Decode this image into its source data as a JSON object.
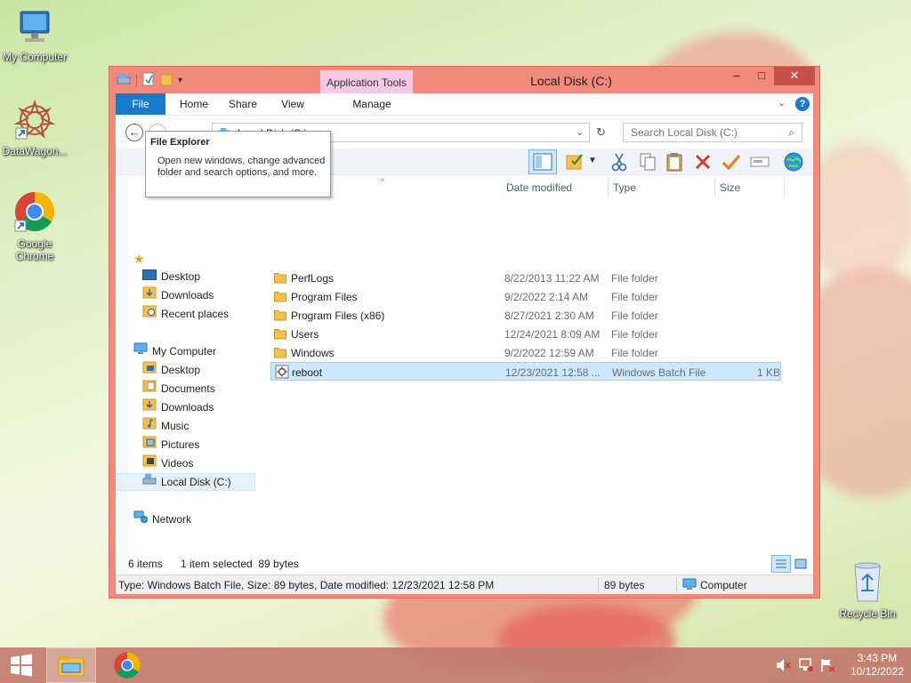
{
  "desktop": {
    "icons": [
      {
        "label": "My Computer"
      },
      {
        "label": "DataWagon..."
      },
      {
        "label": "Google Chrome"
      },
      {
        "label": "Recycle Bin"
      }
    ]
  },
  "window": {
    "title": "Local Disk (C:)",
    "context_tab": "Application Tools",
    "controls": {
      "minimize": "–",
      "maximize": "□",
      "close": "✕"
    }
  },
  "ribbon": {
    "tabs": [
      "File",
      "Home",
      "Share",
      "View",
      "Manage"
    ]
  },
  "address": {
    "path": "Local Disk (C:)",
    "search_placeholder": "Search Local Disk (C:)"
  },
  "tooltip": {
    "title": "File Explorer",
    "body": "Open new windows, change advanced folder and search options, and more."
  },
  "nav": {
    "favorites": [
      "Desktop",
      "Downloads",
      "Recent places"
    ],
    "computer_label": "My Computer",
    "computer_items": [
      "Desktop",
      "Documents",
      "Downloads",
      "Music",
      "Pictures",
      "Videos",
      "Local Disk (C:)"
    ],
    "network_label": "Network"
  },
  "columns": [
    "Date modified",
    "Type",
    "Size"
  ],
  "files": [
    {
      "name": "PerfLogs",
      "date": "8/22/2013 11:22 AM",
      "type": "File folder",
      "size": ""
    },
    {
      "name": "Program Files",
      "date": "9/2/2022 2:14 AM",
      "type": "File folder",
      "size": ""
    },
    {
      "name": "Program Files (x86)",
      "date": "8/27/2021 2:30 AM",
      "type": "File folder",
      "size": ""
    },
    {
      "name": "Users",
      "date": "12/24/2021 8:09 AM",
      "type": "File folder",
      "size": ""
    },
    {
      "name": "Windows",
      "date": "9/2/2022 12:59 AM",
      "type": "File folder",
      "size": ""
    },
    {
      "name": "reboot",
      "date": "12/23/2021 12:58 ...",
      "type": "Windows Batch File",
      "size": "1 KB"
    }
  ],
  "status": {
    "items": "6 items",
    "selected": "1 item selected  89 bytes",
    "details": "Type: Windows Batch File, Size: 89 bytes, Date modified: 12/23/2021 12:58 PM",
    "size": "89 bytes",
    "location": "Computer"
  },
  "clock": {
    "time": "3:43 PM",
    "date": "10/12/2022"
  },
  "colors": {
    "window_frame": "#f28a7c",
    "file_tab": "#1979ca",
    "selection": "#cce8ff",
    "taskbar": "#c27b6c"
  }
}
